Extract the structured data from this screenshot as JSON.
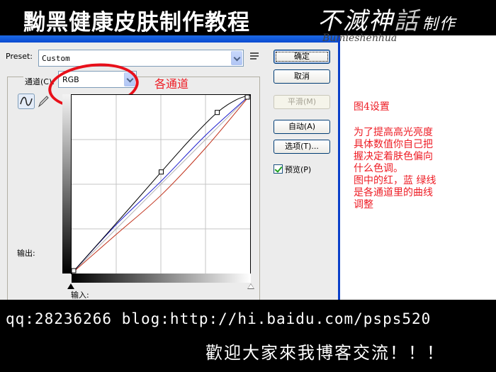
{
  "banner": {
    "title": "黝黑健康皮肤制作教程",
    "brand_main": "不滅神",
    "brand_grey": "話",
    "brand_sub": "制作",
    "brand_signature": "Bumieshenhua"
  },
  "dialog": {
    "preset_label": "Preset:",
    "preset_value": "Custom",
    "channel_label": "通道(C):",
    "channel_value": "RGB",
    "output_label": "输出:",
    "input_label": "输入:",
    "buttons": {
      "ok": "确定",
      "cancel": "取消",
      "smooth": "平滑(M)",
      "auto": "自动(A)",
      "options": "选项(T)..."
    },
    "preview_label": "预览(P)",
    "preview_checked": true
  },
  "annotations": {
    "channels_note": "各通道",
    "highlight_color": "#e8101a"
  },
  "notes": {
    "title": "图4设置",
    "lines": [
      "为了提高高光亮度",
      "具体数值你自己把",
      "握决定着肤色偏向",
      "什么色调。",
      "图中的红，蓝 绿线",
      "是各通道里的曲线",
      "调整"
    ],
    "color": "#ee1c24"
  },
  "curves": {
    "range": [
      0,
      255
    ],
    "rgb_points": [
      [
        0,
        0
      ],
      [
        128,
        145
      ],
      [
        208,
        230
      ],
      [
        255,
        255
      ]
    ],
    "series": [
      {
        "name": "RGB",
        "color": "#000000",
        "points": [
          [
            0,
            0
          ],
          [
            64,
            72
          ],
          [
            128,
            145
          ],
          [
            170,
            192
          ],
          [
            208,
            230
          ],
          [
            235,
            248
          ],
          [
            255,
            255
          ]
        ]
      },
      {
        "name": "Blue",
        "color": "#1a1acc",
        "points": [
          [
            0,
            0
          ],
          [
            64,
            70
          ],
          [
            128,
            132
          ],
          [
            192,
            198
          ],
          [
            255,
            255
          ]
        ]
      },
      {
        "name": "Red",
        "color": "#c0301a",
        "points": [
          [
            0,
            0
          ],
          [
            64,
            56
          ],
          [
            128,
            112
          ],
          [
            192,
            180
          ],
          [
            255,
            255
          ]
        ]
      },
      {
        "name": "Baseline",
        "color": "#b4b4b4",
        "points": [
          [
            0,
            0
          ],
          [
            255,
            255
          ]
        ]
      }
    ]
  },
  "footer": {
    "contact": "qq:28236266  blog:http://hi.baidu.com/psps520",
    "welcome": "歡迎大家來我博客交流！！！"
  }
}
